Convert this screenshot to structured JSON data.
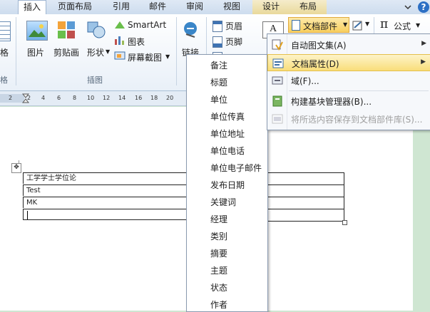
{
  "tabs": [
    "插入",
    "页面布局",
    "引用",
    "邮件",
    "审阅",
    "视图",
    "设计",
    "布局"
  ],
  "help_label": "?",
  "ribbon": {
    "left_partial": "格",
    "left_partial_group": "格",
    "picture": "图片",
    "clipart": "剪贴画",
    "shapes": "形状",
    "smartart": "SmartArt",
    "chart": "图表",
    "screenshot": "屏幕截图",
    "group_illustrations": "插图",
    "link": "链接",
    "header": "页眉",
    "footer": "页脚",
    "quickparts": "文档部件",
    "equation": "公式",
    "equation_symbol": "π",
    "textbox_label": "A"
  },
  "ruler": [
    "2",
    "2",
    "4",
    "6",
    "8",
    "10",
    "12",
    "14",
    "16",
    "18",
    "20"
  ],
  "document": {
    "rows": [
      "工学学士学位论",
      "Test",
      "MK",
      ""
    ]
  },
  "docprops_list": [
    "备注",
    "标题",
    "单位",
    "单位传真",
    "单位地址",
    "单位电话",
    "单位电子邮件",
    "发布日期",
    "关键词",
    "经理",
    "类别",
    "摘要",
    "主题",
    "状态",
    "作者"
  ],
  "parts_menu": [
    {
      "label": "自动图文集(A)",
      "arrow": true,
      "disabled": false
    },
    {
      "label": "文档属性(D)",
      "arrow": true,
      "disabled": false
    },
    {
      "label": "域(F)...",
      "arrow": false,
      "disabled": false
    },
    {
      "label": "构建基块管理器(B)...",
      "arrow": false,
      "disabled": false
    },
    {
      "label": "将所选内容保存到文档部件库(S)...",
      "arrow": false,
      "disabled": true
    }
  ],
  "colors": {
    "highlight": "#f9de7a",
    "page_bg": "#cfe6d2",
    "ribbon_border": "#9fb6d2"
  }
}
